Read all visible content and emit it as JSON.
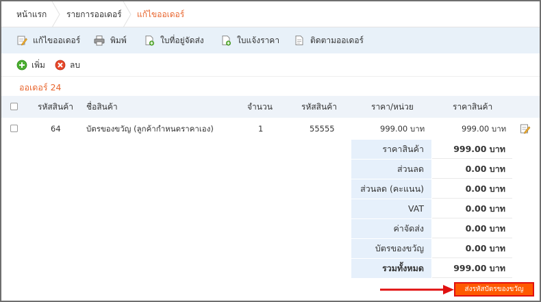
{
  "breadcrumb": [
    "หน้าแรก",
    "รายการออเดอร์",
    "แก้ไขออเดอร์"
  ],
  "toolbar": {
    "edit_order": "แก้ไขออเดอร์",
    "print": "พิมพ์",
    "shipping_slip": "ใบที่อยู่จัดส่ง",
    "quotation": "ใบแจ้งราคา",
    "track_order": "ติดตามออเดอร์"
  },
  "actions": {
    "add": "เพิ่ม",
    "delete": "ลบ"
  },
  "order_title": "ออเดอร์ 24",
  "table": {
    "headers": [
      "รหัสสินค้า",
      "ชื่อสินค้า",
      "จำนวน",
      "รหัสสินค้า",
      "ราคา/หน่วย",
      "ราคาสินค้า"
    ],
    "rows": [
      {
        "id": "64",
        "name": "บัตรของขวัญ (ลูกค้ากำหนดราคาเอง)",
        "qty": "1",
        "code": "55555",
        "unit_price": "999.00 บาท",
        "price": "999.00 บาท"
      }
    ]
  },
  "summary": [
    {
      "label": "ราคาสินค้า",
      "value": "999.00 บาท"
    },
    {
      "label": "ส่วนลด",
      "value": "0.00 บาท"
    },
    {
      "label": "ส่วนลด (คะแนน)",
      "value": "0.00 บาท"
    },
    {
      "label": "VAT",
      "value": "0.00 บาท"
    },
    {
      "label": "ค่าจัดส่ง",
      "value": "0.00 บาท"
    },
    {
      "label": "บัตรของขวัญ",
      "value": "0.00 บาท"
    },
    {
      "label": "รวมทั้งหมด",
      "value": "999.00 บาท"
    }
  ],
  "send_button": "ส่งรหัสบัตรของขวัญ",
  "colors": {
    "accent": "#e8642c",
    "toolbar_bg": "#e8f1f9",
    "summary_label_bg": "#e6f0fb",
    "button_bg": "#ff5a00",
    "arrow": "#e01010"
  }
}
